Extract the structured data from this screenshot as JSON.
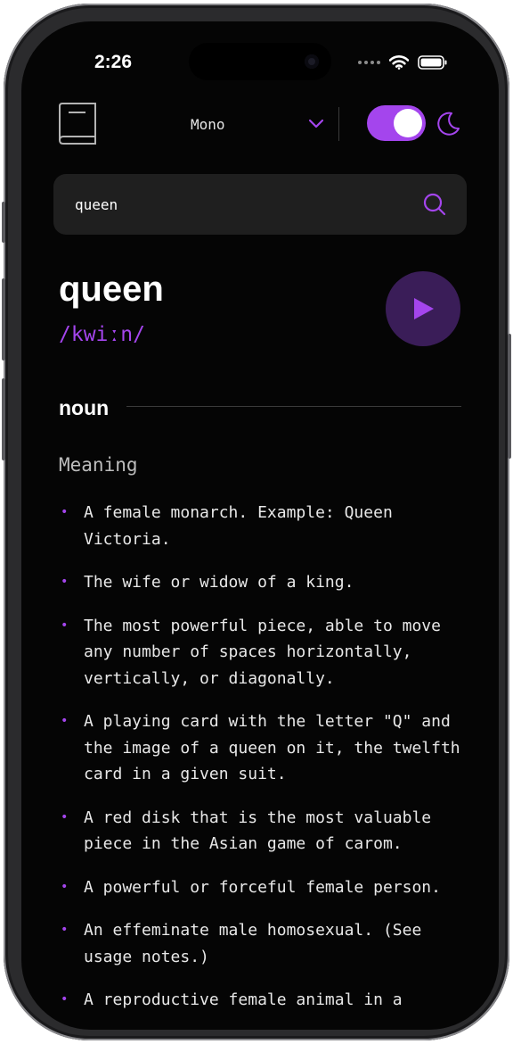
{
  "status": {
    "time": "2:26"
  },
  "header": {
    "font_selected": "Mono"
  },
  "search": {
    "value": "queen"
  },
  "entry": {
    "word": "queen",
    "phonetic": "/kwiːn/",
    "part_of_speech": "noun",
    "meaning_heading": "Meaning",
    "definitions": [
      "A female monarch. Example: Queen Victoria.",
      "The wife or widow of a king.",
      "The most powerful piece, able to move any number of spaces horizontally, vertically, or diagonally.",
      "A playing card with the letter \"Q\" and the image of a queen on it, the twelfth card in a given suit.",
      "A red disk that is the most valuable piece in the Asian game of carom.",
      "A powerful or forceful female person.",
      "An effeminate male homosexual. (See usage notes.)",
      "A reproductive female animal in a"
    ]
  },
  "colors": {
    "accent": "#a445ed",
    "background": "#050505",
    "search_background": "#1f1f1f",
    "play_background": "#3a1d58"
  },
  "icons": [
    "book-icon",
    "chevron-down-icon",
    "moon-icon",
    "search-icon",
    "play-icon",
    "wifi-icon",
    "battery-icon"
  ]
}
